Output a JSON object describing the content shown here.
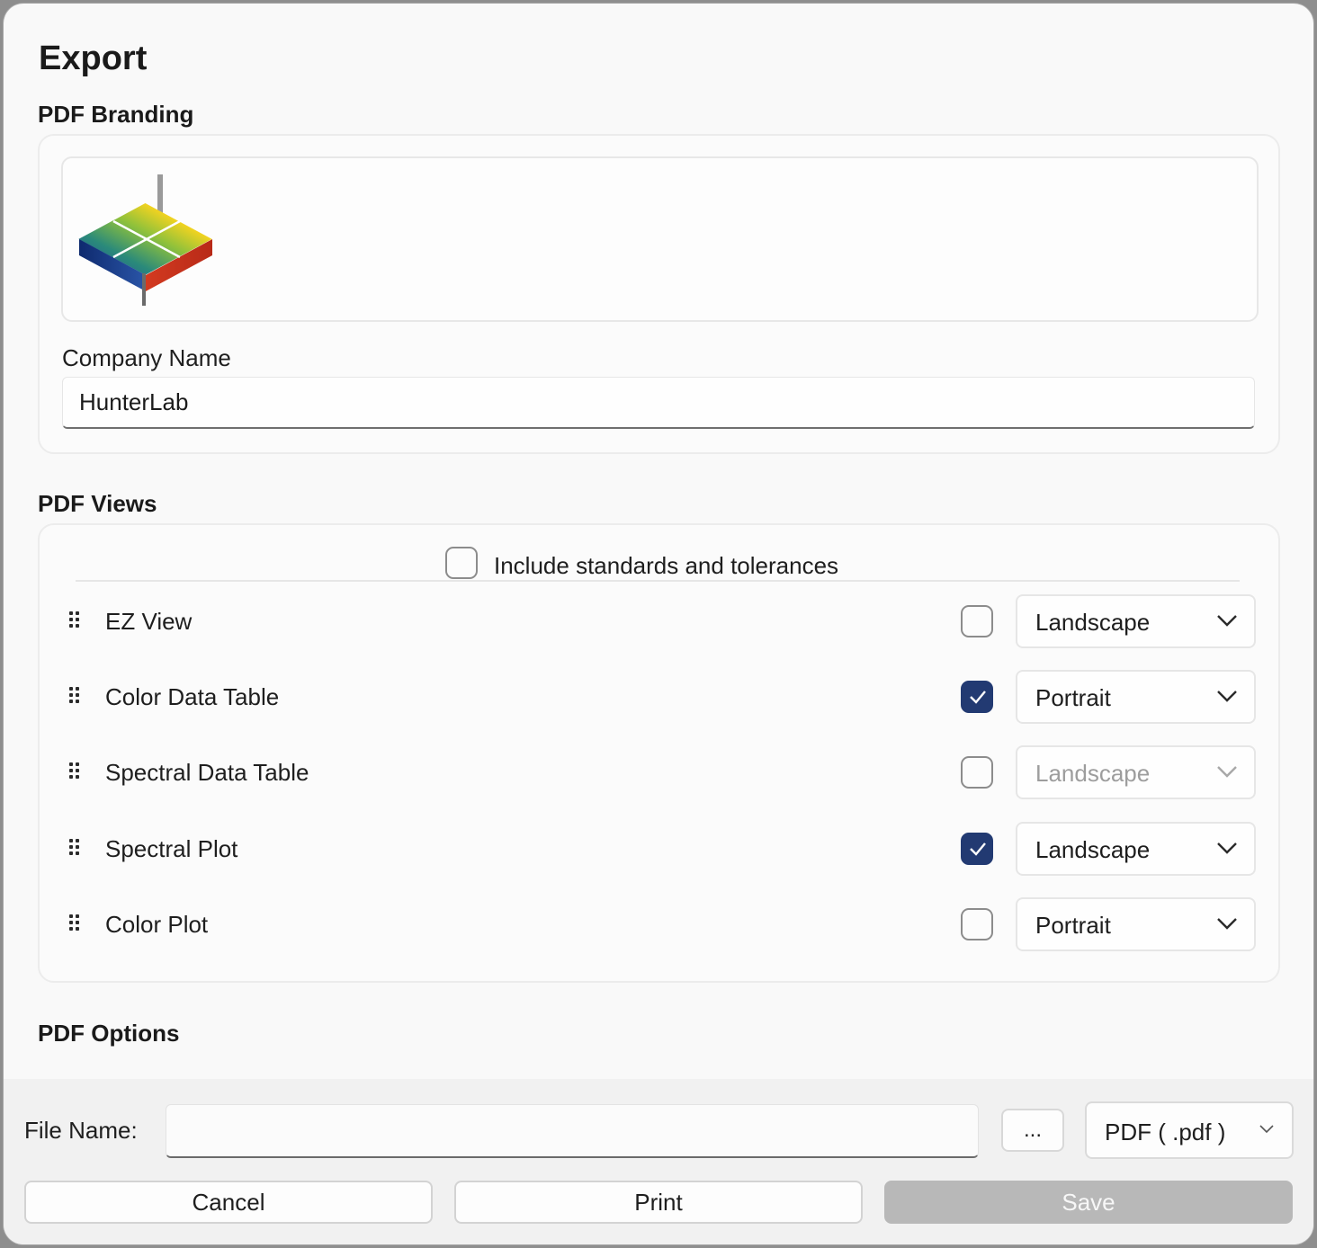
{
  "dialog": {
    "title": "Export"
  },
  "branding": {
    "section_title": "PDF Branding",
    "logo_icon": "hunterlab-logo-icon",
    "company_label": "Company Name",
    "company_value": "HunterLab"
  },
  "views": {
    "section_title": "PDF Views",
    "include_label": "Include standards and tolerances",
    "include_checked": false,
    "items": [
      {
        "label": "EZ View",
        "checked": false,
        "orientation": "Landscape",
        "enabled": true
      },
      {
        "label": "Color Data Table",
        "checked": true,
        "orientation": "Portrait",
        "enabled": true
      },
      {
        "label": "Spectral Data Table",
        "checked": false,
        "orientation": "Landscape",
        "enabled": false
      },
      {
        "label": "Spectral Plot",
        "checked": true,
        "orientation": "Landscape",
        "enabled": true
      },
      {
        "label": "Color Plot",
        "checked": false,
        "orientation": "Portrait",
        "enabled": true
      }
    ]
  },
  "options": {
    "section_title": "PDF Options"
  },
  "footer": {
    "file_name_label": "File Name:",
    "file_name_value": "",
    "browse_label": "...",
    "file_type": "PDF ( .pdf )"
  },
  "buttons": {
    "cancel": "Cancel",
    "print": "Print",
    "save": "Save"
  },
  "colors": {
    "checkbox_checked": "#223a72",
    "save_disabled": "#b8b8b8"
  }
}
